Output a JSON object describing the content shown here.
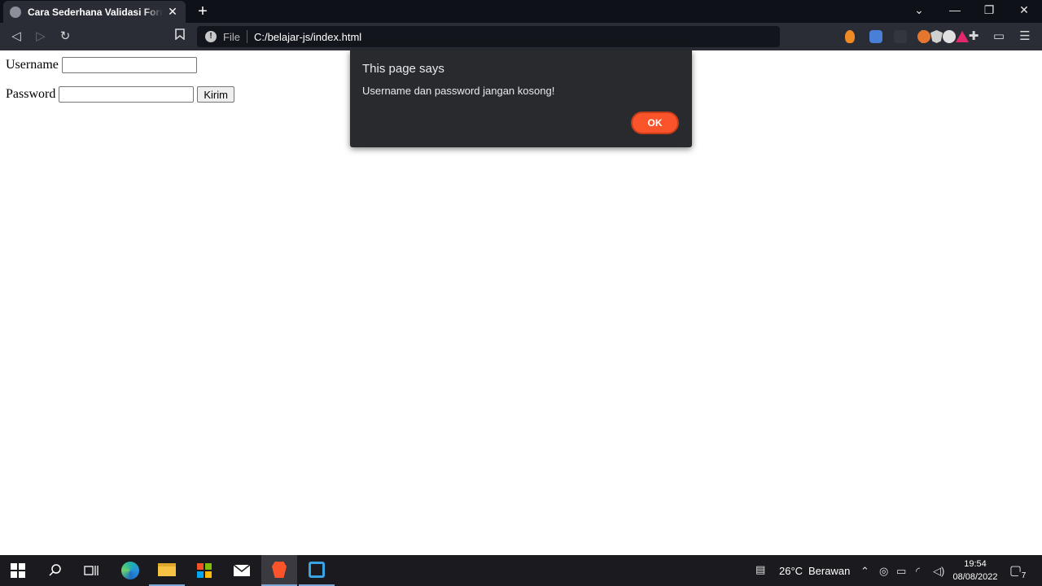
{
  "browser": {
    "tab": {
      "title": "Cara Sederhana Validasi Form HTML"
    },
    "omnibox": {
      "scheme": "File",
      "url": "C:/belajar-js/index.html"
    },
    "icons": {
      "back": "back-icon",
      "forward": "forward-icon",
      "reload": "reload-icon",
      "bookmark": "bookmark-icon",
      "info": "info-icon",
      "shields": "brave-shields-icon",
      "rewards": "brave-rewards-icon",
      "extensions": "puzzle-icon",
      "wallet": "wallet-icon",
      "menu": "hamburger-menu-icon"
    },
    "accent_color": "#fb542b"
  },
  "page": {
    "username_label": "Username",
    "password_label": "Password",
    "submit_label": "Kirim"
  },
  "dialog": {
    "title": "This page says",
    "message": "Username dan password jangan kosong!",
    "ok_label": "OK"
  },
  "taskbar": {
    "weather": {
      "temperature": "26°C",
      "condition": "Berawan"
    },
    "clock": {
      "time": "19:54",
      "date": "08/08/2022"
    },
    "notification_count": "7"
  }
}
